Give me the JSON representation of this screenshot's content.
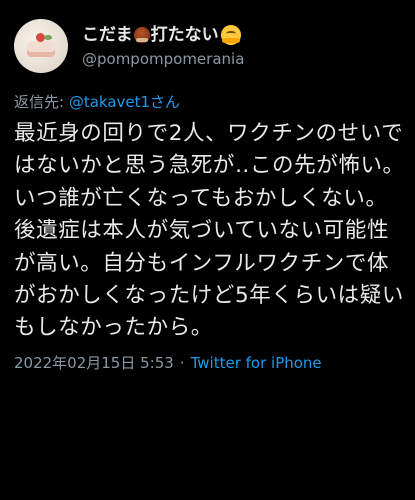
{
  "author": {
    "display_name_before": "こだま",
    "display_name_after": "打たない",
    "emoji_1": "chestnut-emoji",
    "emoji_2": "hugging-face-emoji",
    "handle": "@pompompomerania"
  },
  "reply": {
    "prefix": "返信先: ",
    "mention": "@takavet1さん"
  },
  "tweet": {
    "text": "最近身の回りで2人、ワクチンのせいではないかと思う急死が‥この先が怖い。いつ誰が亡くなってもおかしくない。後遺症は本人が気づいていない可能性が高い。自分もインフルワクチンで体がおかしくなったけど5年くらいは疑いもしなかったから。"
  },
  "meta": {
    "timestamp": "2022年02月15日 5:53",
    "separator": "·",
    "source": "Twitter for iPhone"
  },
  "colors": {
    "background": "#000000",
    "text": "#e7e9ea",
    "secondary": "#8b98a5",
    "link": "#1d9bf0"
  }
}
